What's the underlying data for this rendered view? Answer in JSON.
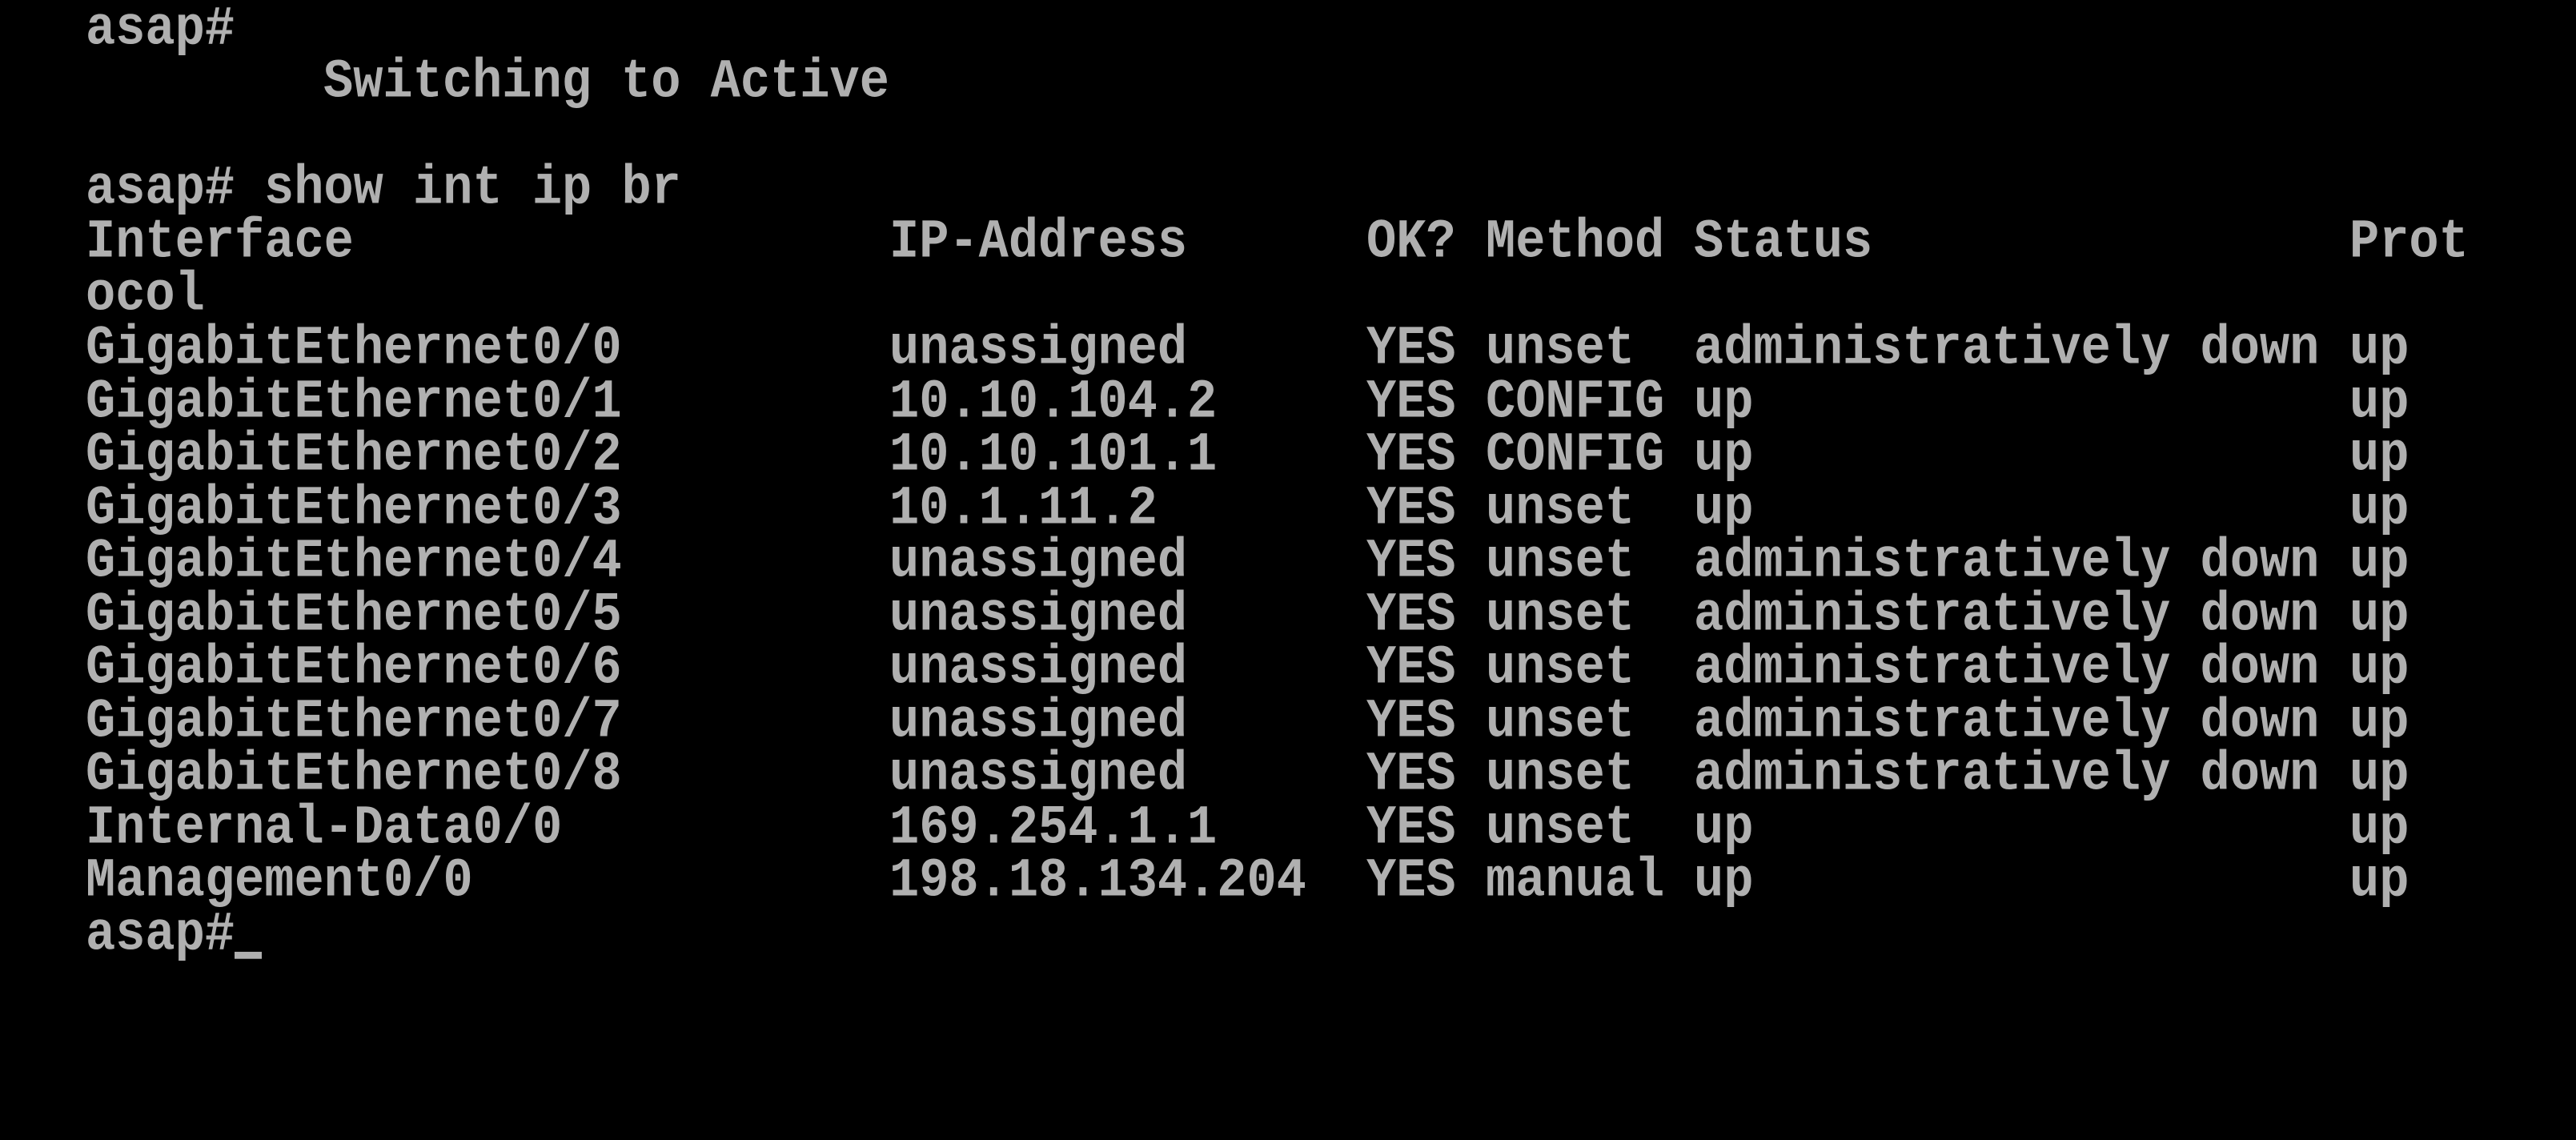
{
  "terminal": {
    "prompt1": "asap#",
    "message": "Switching to Active",
    "prompt2": "asap#",
    "command": "show int ip br",
    "header": {
      "interface": "Interface",
      "ip": "IP-Address",
      "ok": "OK?",
      "method": "Method",
      "status": "Status",
      "protocol_part1": "Prot",
      "protocol_part2": "ocol"
    },
    "rows": [
      {
        "interface": "GigabitEthernet0/0",
        "ip": "unassigned",
        "ok": "YES",
        "method": "unset",
        "status": "administratively down",
        "protocol": "up"
      },
      {
        "interface": "GigabitEthernet0/1",
        "ip": "10.10.104.2",
        "ok": "YES",
        "method": "CONFIG",
        "status": "up",
        "protocol": "up"
      },
      {
        "interface": "GigabitEthernet0/2",
        "ip": "10.10.101.1",
        "ok": "YES",
        "method": "CONFIG",
        "status": "up",
        "protocol": "up"
      },
      {
        "interface": "GigabitEthernet0/3",
        "ip": "10.1.11.2",
        "ok": "YES",
        "method": "unset",
        "status": "up",
        "protocol": "up"
      },
      {
        "interface": "GigabitEthernet0/4",
        "ip": "unassigned",
        "ok": "YES",
        "method": "unset",
        "status": "administratively down",
        "protocol": "up"
      },
      {
        "interface": "GigabitEthernet0/5",
        "ip": "unassigned",
        "ok": "YES",
        "method": "unset",
        "status": "administratively down",
        "protocol": "up"
      },
      {
        "interface": "GigabitEthernet0/6",
        "ip": "unassigned",
        "ok": "YES",
        "method": "unset",
        "status": "administratively down",
        "protocol": "up"
      },
      {
        "interface": "GigabitEthernet0/7",
        "ip": "unassigned",
        "ok": "YES",
        "method": "unset",
        "status": "administratively down",
        "protocol": "up"
      },
      {
        "interface": "GigabitEthernet0/8",
        "ip": "unassigned",
        "ok": "YES",
        "method": "unset",
        "status": "administratively down",
        "protocol": "up"
      },
      {
        "interface": "Internal-Data0/0",
        "ip": "169.254.1.1",
        "ok": "YES",
        "method": "unset",
        "status": "up",
        "protocol": "up"
      },
      {
        "interface": "Management0/0",
        "ip": "198.18.134.204",
        "ok": "YES",
        "method": "manual",
        "status": "up",
        "protocol": "up"
      }
    ],
    "prompt3": "asap#"
  }
}
